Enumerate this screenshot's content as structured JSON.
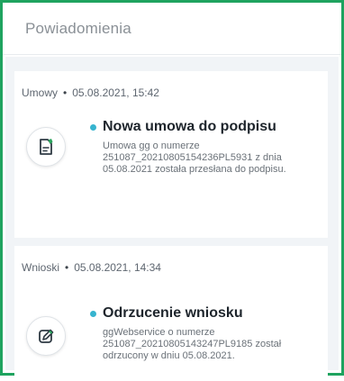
{
  "panel": {
    "title": "Powiadomienia"
  },
  "notifications": [
    {
      "category": "Umowy",
      "datetime": "05.08.2021, 15:42",
      "title": "Nowa umowa do podpisu",
      "description": "Umowa gg o numerze 251087_20210805154236PL5931 z dnia 05.08.2021 została przesłana do podpisu.",
      "icon": "document-pen-icon",
      "unread": true
    },
    {
      "category": "Wnioski",
      "datetime": "05.08.2021, 14:34",
      "title": "Odrzucenie wniosku",
      "description": "ggWebservice o numerze 251087_20210805143247PL9185 został odrzucony w dniu 05.08.2021.",
      "icon": "edit-pencil-icon",
      "unread": true
    }
  ],
  "colors": {
    "border_accent": "#1fa35f",
    "unread_dot": "#37b4cf",
    "icon_accent": "#2aa45c",
    "body_bg": "#f1f4f7"
  }
}
